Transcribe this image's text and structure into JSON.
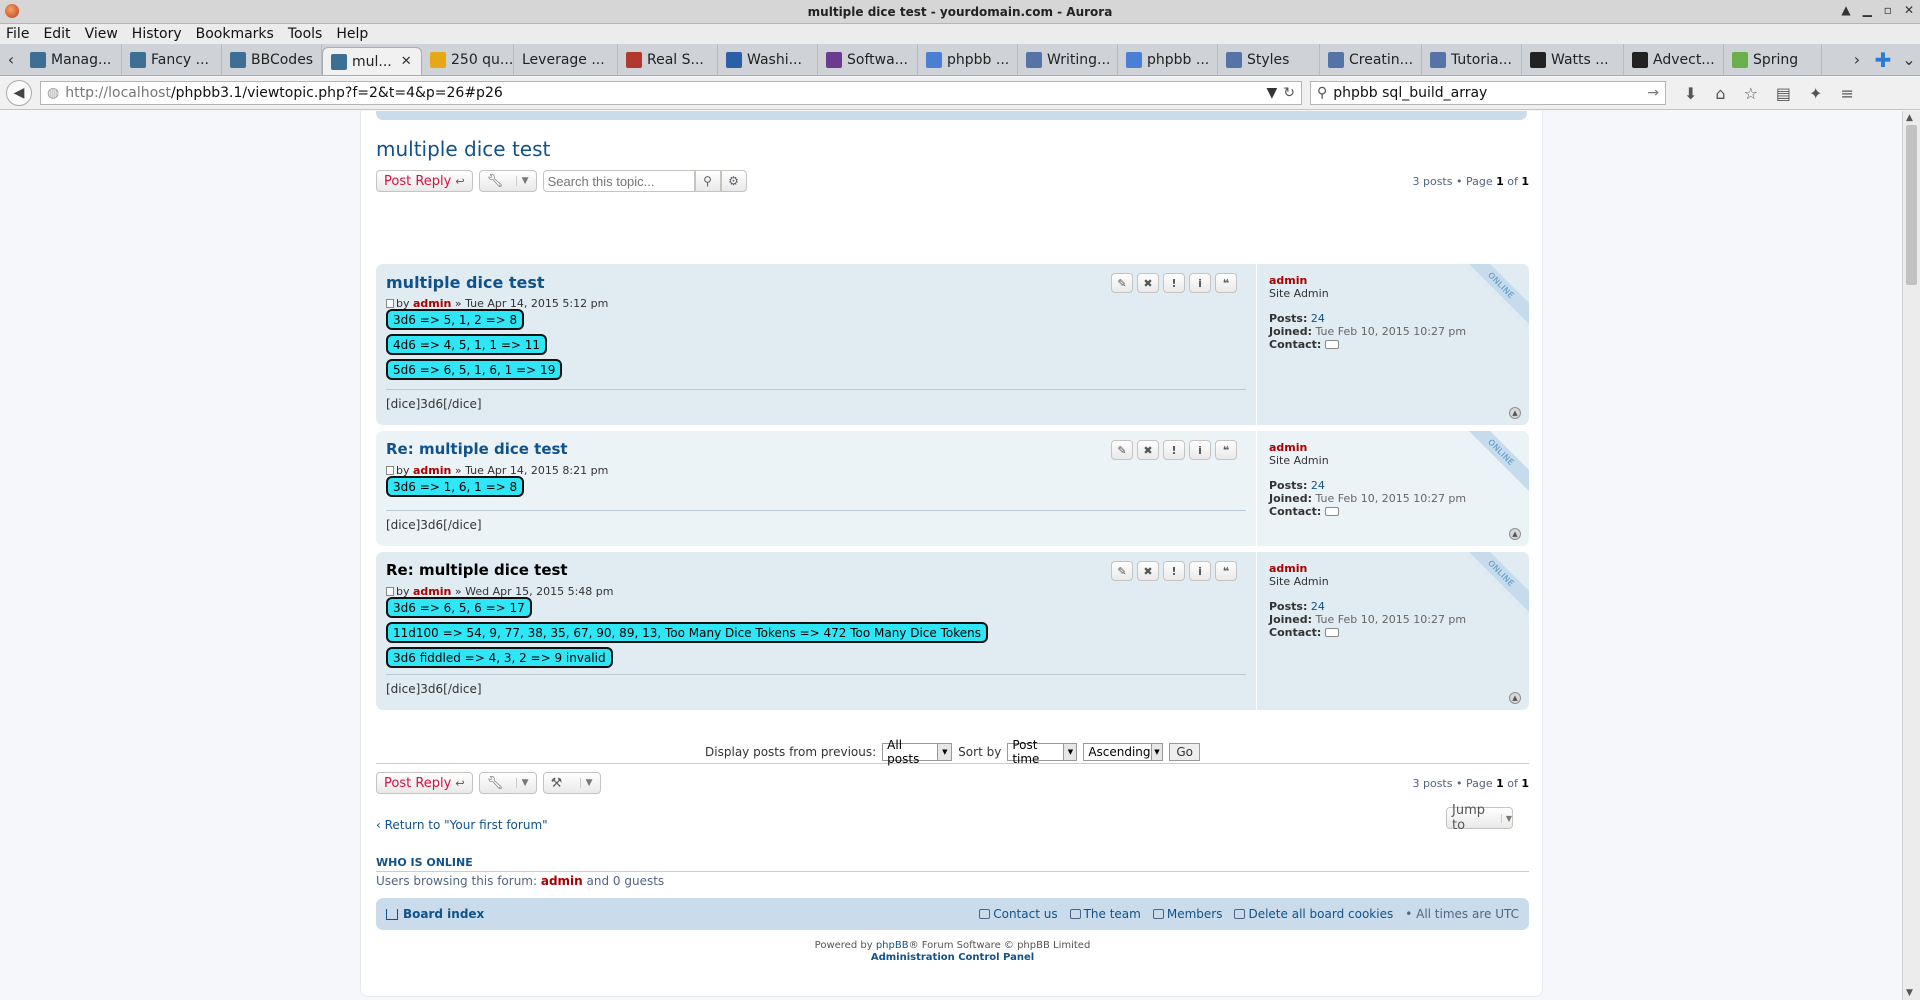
{
  "window": {
    "title": "multiple dice test - yourdomain.com - Aurora"
  },
  "menu": [
    "File",
    "Edit",
    "View",
    "History",
    "Bookmarks",
    "Tools",
    "Help"
  ],
  "tabs": [
    {
      "label": "Manag...",
      "color": "#3d6e94"
    },
    {
      "label": "Fancy ...",
      "color": "#3d6e94"
    },
    {
      "label": "BBCodes",
      "color": "#3d6e94"
    },
    {
      "label": "mul...",
      "color": "#3d6e94",
      "active": true
    },
    {
      "label": "250 qu...",
      "color": "#e6a817"
    },
    {
      "label": "Leverage ...",
      "color": ""
    },
    {
      "label": "Real S...",
      "color": "#b03a2e"
    },
    {
      "label": "Washi...",
      "color": "#2b60a8"
    },
    {
      "label": "Softwa...",
      "color": "#6c3a8f"
    },
    {
      "label": "phpbb ...",
      "color": "#4a7fd4"
    },
    {
      "label": "Writing...",
      "color": "#5573a6"
    },
    {
      "label": "phpbb ...",
      "color": "#4a7fd4"
    },
    {
      "label": "Styles",
      "color": "#5573a6"
    },
    {
      "label": "Creatin...",
      "color": "#5573a6"
    },
    {
      "label": "Tutoria...",
      "color": "#5573a6"
    },
    {
      "label": "Watts ...",
      "color": "#222"
    },
    {
      "label": "Advect...",
      "color": "#222"
    },
    {
      "label": "Spring",
      "color": "#6ab04c"
    }
  ],
  "nav": {
    "url_host": "http://localhost",
    "url_path": "/phpbb3.1/viewtopic.php?f=2&t=4&p=26#p26",
    "search": "phpbb sql_build_array"
  },
  "topic": {
    "title": "multiple dice test",
    "post_reply": "Post Reply",
    "search_placeholder": "Search this topic...",
    "pagination": {
      "count": "3 posts",
      "sep": " • Page ",
      "current": "1",
      "of": " of ",
      "total": "1"
    }
  },
  "posts": [
    {
      "title": "multiple dice test",
      "by": "by",
      "author": "admin",
      "date": " » Tue Apr 14, 2015 5:12 pm",
      "dice": [
        "3d6 => 5, 1, 2 => 8",
        "4d6 => 4, 5, 1, 1 => 11",
        "5d6 => 6, 5, 1, 6, 1 => 19"
      ],
      "signature": "[dice]3d6[/dice]",
      "profile": {
        "name": "admin",
        "rank": "Site Admin",
        "posts_label": "Posts:",
        "posts": "24",
        "joined_label": "Joined:",
        "joined": "Tue Feb 10, 2015 10:27 pm",
        "contact_label": "Contact:"
      },
      "status": "ONLINE"
    },
    {
      "title": "Re: multiple dice test",
      "by": "by",
      "author": "admin",
      "date": " » Tue Apr 14, 2015 8:21 pm",
      "dice": [
        "3d6 => 1, 6, 1 => 8"
      ],
      "signature": "[dice]3d6[/dice]",
      "profile": {
        "name": "admin",
        "rank": "Site Admin",
        "posts_label": "Posts:",
        "posts": "24",
        "joined_label": "Joined:",
        "joined": "Tue Feb 10, 2015 10:27 pm",
        "contact_label": "Contact:"
      },
      "status": "ONLINE"
    },
    {
      "title": "Re: multiple dice test",
      "by": "by",
      "author": "admin",
      "date": " » Wed Apr 15, 2015 5:48 pm",
      "dice": [
        "3d6 => 6, 5, 6 => 17",
        "11d100 => 54, 9, 77, 38, 35, 67, 90, 89, 13, Too Many Dice Tokens => 472 Too Many Dice Tokens",
        "3d6 fiddled => 4, 3, 2 => 9 invalid"
      ],
      "signature": "[dice]3d6[/dice]",
      "profile": {
        "name": "admin",
        "rank": "Site Admin",
        "posts_label": "Posts:",
        "posts": "24",
        "joined_label": "Joined:",
        "joined": "Tue Feb 10, 2015 10:27 pm",
        "contact_label": "Contact:"
      },
      "status": "ONLINE"
    }
  ],
  "display": {
    "label": "Display posts from previous:",
    "posts_value": "All posts",
    "sort_label": "Sort by",
    "sort_value": "Post time",
    "order_value": "Ascending",
    "go": "Go"
  },
  "return_link": "Return to \"Your first forum\"",
  "jump_to": "Jump to",
  "who_online": {
    "heading": "WHO IS ONLINE",
    "prefix": "Users browsing this forum: ",
    "user": "admin",
    "suffix": " and 0 guests"
  },
  "footer": {
    "board_index": "Board index",
    "contact": "Contact us",
    "team": "The team",
    "members": "Members",
    "cookies": "Delete all board cookies",
    "times": "• All times are UTC",
    "powered_prefix": "Powered by ",
    "phpbb": "phpBB",
    "powered_suffix": "® Forum Software © phpBB Limited",
    "acp": "Administration Control Panel"
  }
}
